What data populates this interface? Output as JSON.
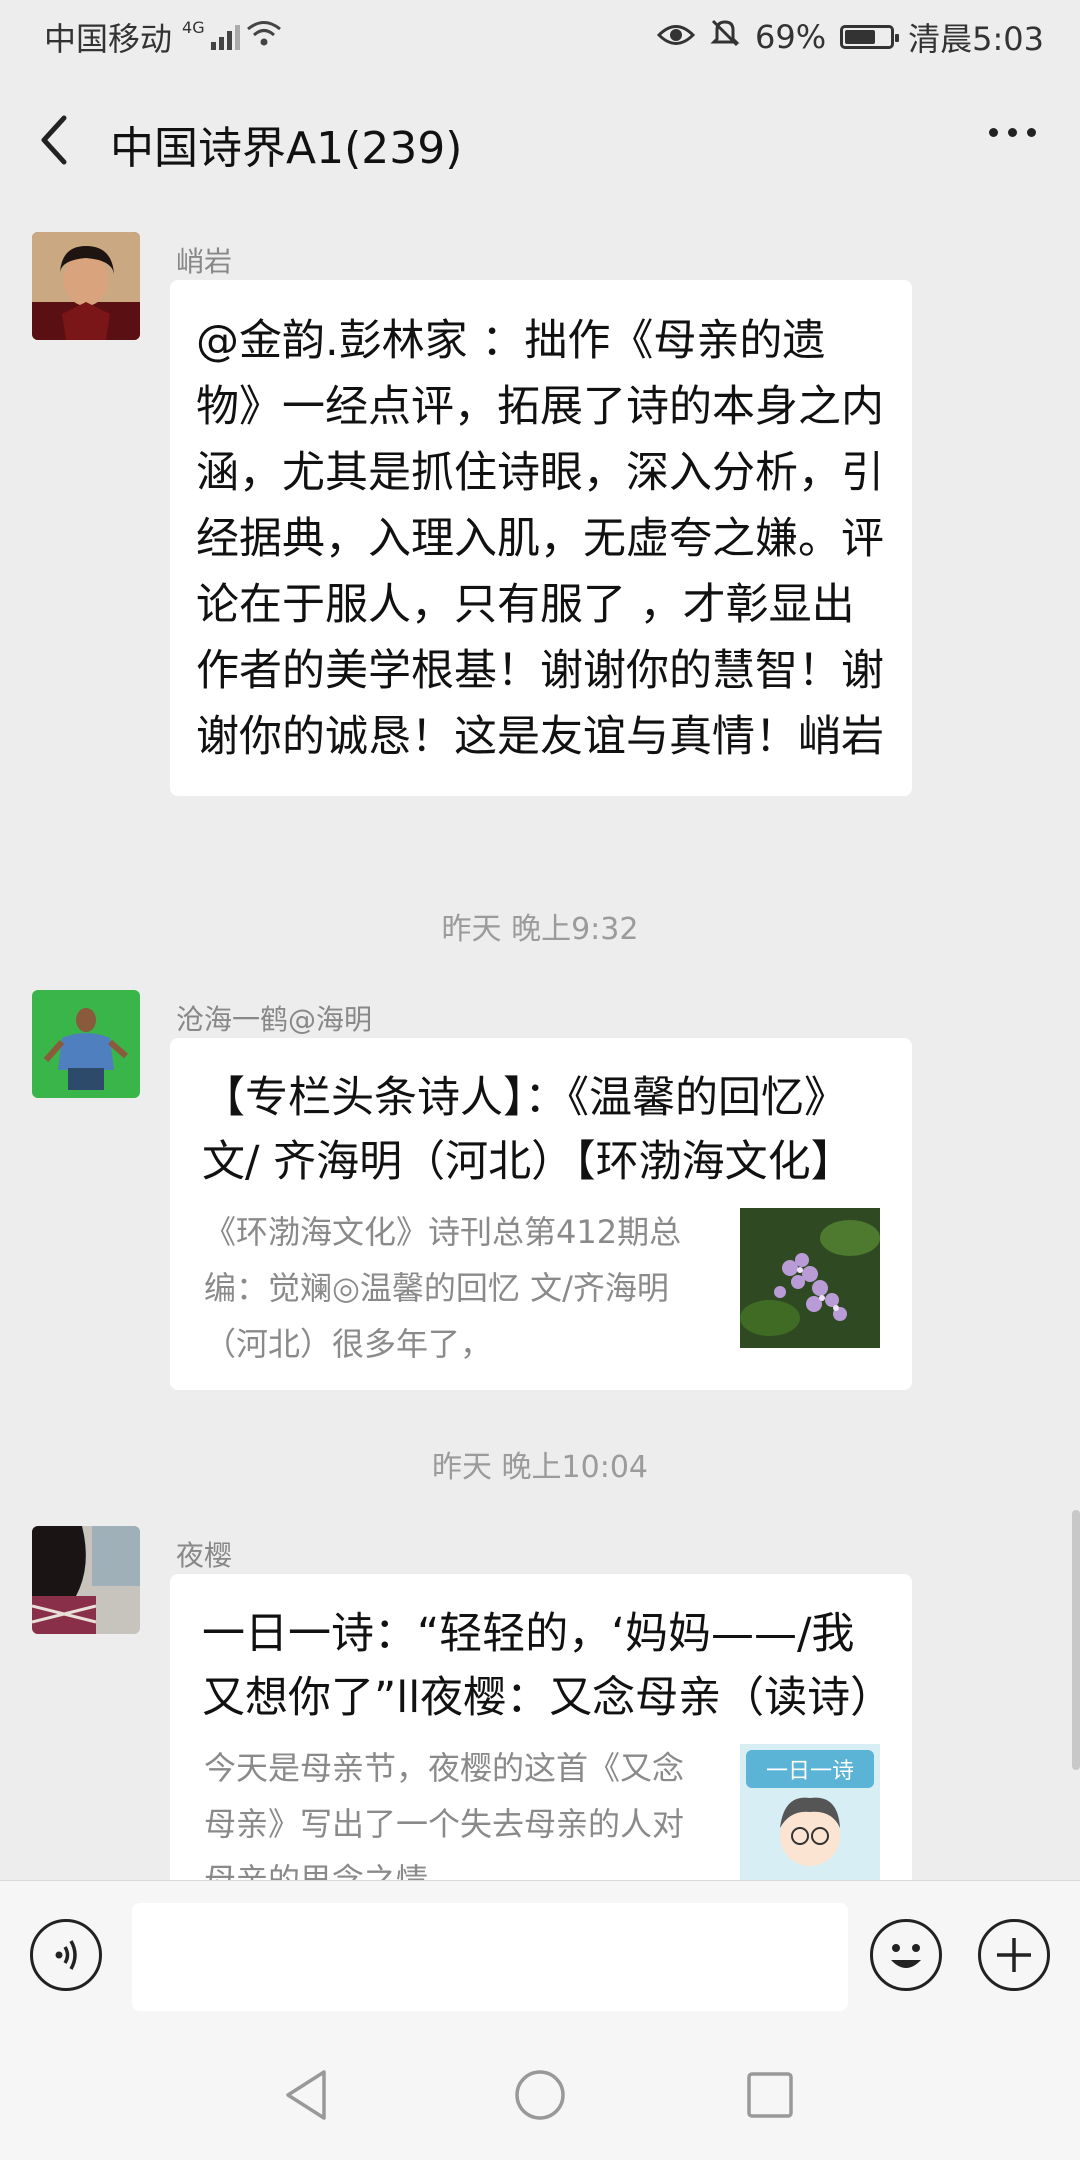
{
  "status_bar": {
    "carrier": "中国移动",
    "network": "4G",
    "battery": "69%",
    "battery_level": 0.69,
    "time": "清晨5:03"
  },
  "header": {
    "title": "中国诗界A1(239)"
  },
  "messages": [
    {
      "type": "text",
      "sender": "峭岩",
      "text": "@金韵.彭林家 ：拙作《母亲的遗物》一经点评，拓展了诗的本身之内涵，尤其是抓住诗眼，深入分析，引经据典，入理入肌，无虚夸之嫌。评论在于服人，只有服了 ，才彰显出作者的美学根基！谢谢你的慧智！谢谢你的诚恳！这是友谊与真情！峭岩"
    },
    {
      "type": "time",
      "text": "昨天 晚上9:32"
    },
    {
      "type": "link",
      "sender": "沧海一鹤@海明",
      "title": "【专栏头条诗人】：《温馨的回忆》文/ 齐海明（河北）【环渤海文化】",
      "desc": "《环渤海文化》诗刊总第412期总编：觉斓◎温馨的回忆 文/齐海明（河北）很多年了，"
    },
    {
      "type": "time",
      "text": "昨天 晚上10:04"
    },
    {
      "type": "link",
      "sender": "夜樱",
      "title": "一日一诗：“轻轻的，‘妈妈——/我又想你了”ll夜樱：又念母亲（读诗）",
      "desc": "今天是母亲节，夜樱的这首《又念母亲》写出了一个失去母亲的人对母亲的思念之情",
      "thumb_text": "一日一诗"
    }
  ]
}
